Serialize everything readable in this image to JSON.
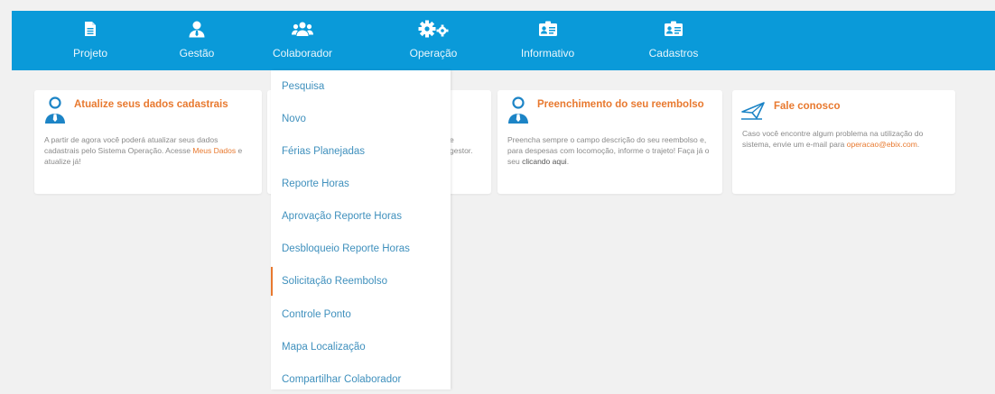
{
  "nav": {
    "items": [
      {
        "label": "Projeto",
        "icon": "file-icon"
      },
      {
        "label": "Gestão",
        "icon": "user-tie-icon"
      },
      {
        "label": "Colaborador",
        "icon": "users-icon"
      },
      {
        "label": "Operação",
        "icon": "gears-icon"
      },
      {
        "label": "Informativo",
        "icon": "id-card-icon"
      },
      {
        "label": "Cadastros",
        "icon": "id-card-icon"
      }
    ]
  },
  "dropdown": {
    "items": [
      "Pesquisa",
      "Novo",
      "Férias Planejadas",
      "Reporte Horas",
      "Aprovação Reporte Horas",
      "Desbloqueio Reporte Horas",
      "Solicitação Reembolso",
      "Controle Ponto",
      "Mapa Localização",
      "Compartilhar Colaborador"
    ]
  },
  "cards": {
    "update": {
      "title": "Atualize seus dados cadastrais",
      "body_pre": "A partir de agora você poderá atualizar seus dados cadastrais pelo Sistema Operação. Acesse ",
      "link": "Meus Dados",
      "body_post": " e atualize já!"
    },
    "hidden": {
      "line1": "e",
      "line2": "gestor."
    },
    "reimb": {
      "title": "Preenchimento do seu reembolso",
      "body_pre": "Preencha sempre o campo descrição do seu reembolso e, para despesas com locomoção, informe o trajeto! Faça já o seu ",
      "link": "clicando aqui",
      "body_post": "."
    },
    "contact": {
      "title": "Fale conosco",
      "body": "Caso você encontre algum problema na utilização do sistema, envie um e-mail para ",
      "email": "operacao@ebix.com",
      "body_post": "."
    }
  },
  "colors": {
    "topbar": "#0a9ad9",
    "accent": "#e8792f",
    "menu_text": "#3f90bd",
    "icon_blue": "#1c84c6"
  }
}
